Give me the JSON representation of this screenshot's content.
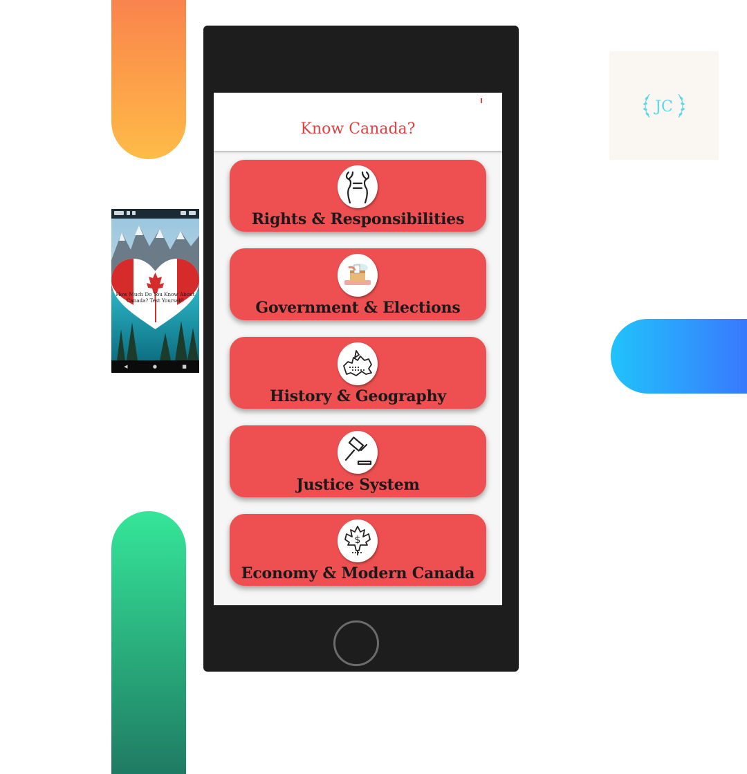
{
  "app": {
    "title": "Know Canada?",
    "accent_color": "#ee5051",
    "title_color": "#e0413f"
  },
  "categories": [
    {
      "label": "Rights & Responsibilities",
      "icon": "rights-balance-icon"
    },
    {
      "label": "Government & Elections",
      "icon": "ballot-box-icon"
    },
    {
      "label": "History & Geography",
      "icon": "canada-map-icon"
    },
    {
      "label": "Justice System",
      "icon": "gavel-icon"
    },
    {
      "label": "Economy & Modern Canada",
      "icon": "maple-leaf-dollar-icon"
    }
  ],
  "splash": {
    "headline": "How Much Do You Know About Canada? Test Yourself!",
    "nav": {
      "back": "◀",
      "home": "●",
      "recents": "■"
    }
  },
  "logo": {
    "text": "JC",
    "color": "#58d8ea"
  }
}
